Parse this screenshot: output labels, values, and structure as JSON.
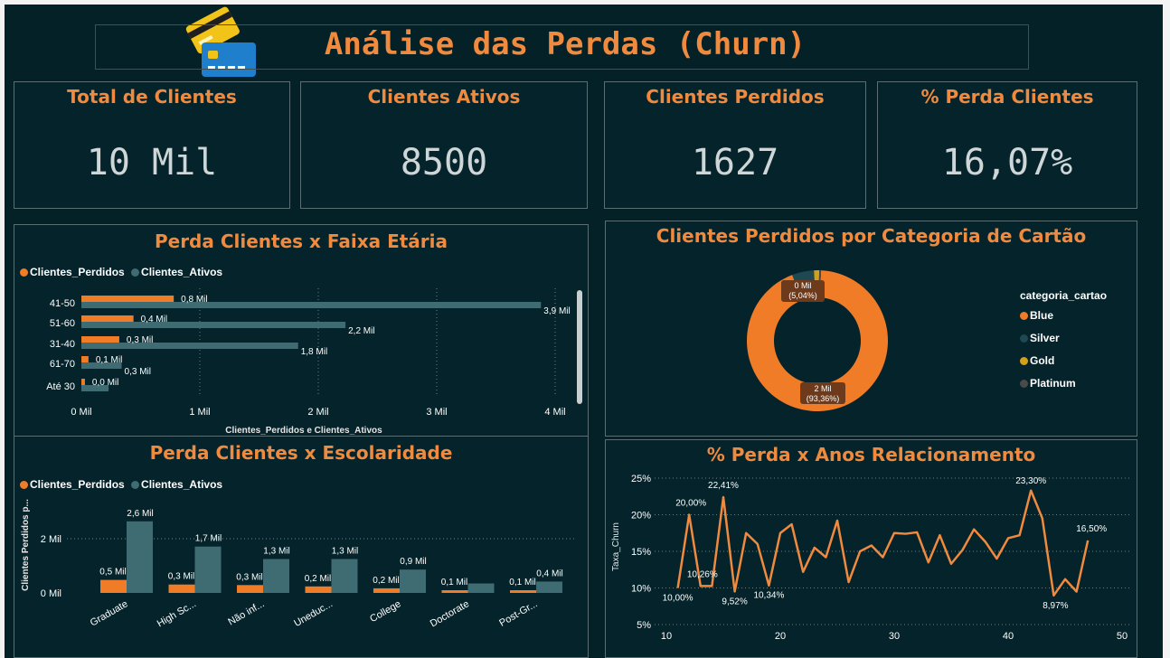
{
  "header": {
    "title": "Análise das Perdas (Churn)"
  },
  "kpis": [
    {
      "label": "Total de Clientes",
      "value": "10 Mil"
    },
    {
      "label": "Clientes Ativos",
      "value": "8500"
    },
    {
      "label": "Clientes Perdidos",
      "value": "1627"
    },
    {
      "label": "% Perda Clientes",
      "value": "16,07%"
    }
  ],
  "colors": {
    "perdidos": "#f07c27",
    "ativos": "#3f6b72",
    "blue": "#f07c27",
    "silver": "#1f4952",
    "gold": "#d4a017",
    "platinum": "#4a4a4a",
    "title": "#f08a3e",
    "background": "#042127"
  },
  "age_chart": {
    "title": "Perda Clientes x Faixa Etária",
    "legend": [
      "Clientes_Perdidos",
      "Clientes_Ativos"
    ],
    "xlabel": "Clientes_Perdidos e Clientes_Ativos",
    "xticks": [
      "0 Mil",
      "1 Mil",
      "2 Mil",
      "3 Mil",
      "4 Mil"
    ]
  },
  "card_chart": {
    "title": "Clientes Perdidos por Categoria de Cartão",
    "legend_title": "categoria_cartao",
    "legend": [
      "Blue",
      "Silver",
      "Gold",
      "Platinum"
    ],
    "label_small": [
      "0 Mil",
      "(5,04%)"
    ],
    "label_big": [
      "2 Mil",
      "(93,36%)"
    ]
  },
  "edu_chart": {
    "title": "Perda Clientes x Escolaridade",
    "legend": [
      "Clientes_Perdidos",
      "Clientes_Ativos"
    ],
    "ylabel": "Clientes Perdidos p...",
    "yticks": [
      "0 Mil",
      "2 Mil"
    ]
  },
  "churn_chart": {
    "title": "% Perda x Anos Relacionamento",
    "ylabel": "Taxa_Churn"
  },
  "chart_data": [
    {
      "type": "bar",
      "orientation": "horizontal",
      "title": "Perda Clientes x Faixa Etária",
      "xlabel": "Clientes_Perdidos e Clientes_Ativos",
      "xlim": [
        0,
        4000
      ],
      "categories": [
        "41-50",
        "51-60",
        "31-40",
        "61-70",
        "Até 30"
      ],
      "series": [
        {
          "name": "Clientes_Perdidos",
          "values": [
            780,
            440,
            320,
            60,
            30
          ],
          "labels": [
            "0,8 Mil",
            "0,4 Mil",
            "0,3 Mil",
            "0,1 Mil",
            "0,0 Mil"
          ]
        },
        {
          "name": "Clientes_Ativos",
          "values": [
            3880,
            2230,
            1830,
            340,
            230
          ],
          "labels": [
            "3,9 Mil",
            "2,2 Mil",
            "1,8 Mil",
            "0,3 Mil",
            ""
          ]
        }
      ]
    },
    {
      "type": "pie",
      "donut": true,
      "title": "Clientes Perdidos por Categoria de Cartão",
      "categories": [
        "Blue",
        "Silver",
        "Gold",
        "Platinum"
      ],
      "values": [
        93.36,
        5.04,
        1.2,
        0.4
      ]
    },
    {
      "type": "bar",
      "title": "Perda Clientes x Escolaridade",
      "ylim": [
        0,
        3000
      ],
      "categories": [
        "Graduate",
        "High Sc...",
        "Não inf...",
        "Uneduc...",
        "College",
        "Doctorate",
        "Post-Gr..."
      ],
      "series": [
        {
          "name": "Clientes_Perdidos",
          "values": [
            480,
            310,
            290,
            240,
            170,
            100,
            100
          ],
          "labels": [
            "0,5 Mil",
            "0,3 Mil",
            "0,3 Mil",
            "0,2 Mil",
            "0,2 Mil",
            "0,1 Mil",
            "0,1 Mil"
          ]
        },
        {
          "name": "Clientes_Ativos",
          "values": [
            2640,
            1710,
            1250,
            1250,
            860,
            350,
            420
          ],
          "labels": [
            "2,6 Mil",
            "1,7 Mil",
            "1,3 Mil",
            "1,3 Mil",
            "0,9 Mil",
            "",
            "0,4 Mil"
          ]
        }
      ]
    },
    {
      "type": "line",
      "title": "% Perda x Anos Relacionamento",
      "ylabel": "Taxa_Churn",
      "xlim": [
        10,
        50
      ],
      "ylim": [
        5,
        25
      ],
      "xticks": [
        10,
        20,
        30,
        40,
        50
      ],
      "yticks": [
        "5%",
        "10%",
        "15%",
        "20%",
        "25%"
      ],
      "x": [
        11,
        12,
        13,
        14,
        15,
        16,
        17,
        18,
        19,
        20,
        21,
        22,
        23,
        24,
        25,
        26,
        27,
        28,
        29,
        30,
        31,
        32,
        33,
        34,
        35,
        36,
        37,
        38,
        39,
        40,
        41,
        42,
        43,
        44,
        45,
        46,
        47
      ],
      "y": [
        10.0,
        20.0,
        10.26,
        10.26,
        22.41,
        9.52,
        17.5,
        16.0,
        10.34,
        17.5,
        18.7,
        12.2,
        15.5,
        14.2,
        19.2,
        10.8,
        15.0,
        15.8,
        14.2,
        17.5,
        17.4,
        17.6,
        13.5,
        17.2,
        13.3,
        15.2,
        18.0,
        16.3,
        14.0,
        16.8,
        17.2,
        23.3,
        19.5,
        8.97,
        11.2,
        9.5,
        16.5
      ],
      "point_labels": [
        {
          "x": 11,
          "label": "10,00%"
        },
        {
          "x": 12,
          "label": "20,00%"
        },
        {
          "x": 13,
          "label": "10,26%"
        },
        {
          "x": 15,
          "label": "22,41%"
        },
        {
          "x": 16,
          "label": "9,52%"
        },
        {
          "x": 19,
          "label": "10,34%"
        },
        {
          "x": 42,
          "label": "23,30%"
        },
        {
          "x": 44,
          "label": "8,97%"
        },
        {
          "x": 47,
          "label": "16,50%"
        }
      ]
    }
  ]
}
